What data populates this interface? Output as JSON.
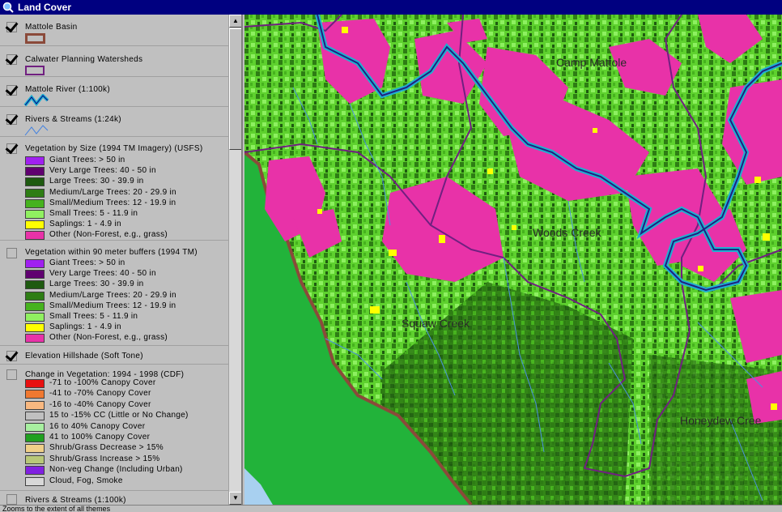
{
  "window": {
    "title": "Land Cover"
  },
  "legend": {
    "themes": [
      {
        "name": "Mattole Basin",
        "checked": true
      },
      {
        "name": "Calwater Planning Watersheds",
        "checked": true
      },
      {
        "name": "Mattole River (1:100k)",
        "checked": true
      },
      {
        "name": "Rivers & Streams (1:24k)",
        "checked": true
      },
      {
        "name": "Vegetation by Size (1994 TM Imagery) (USFS)",
        "checked": true,
        "classes": [
          {
            "label": "Giant Trees: > 50 in",
            "color": "#a020f0"
          },
          {
            "label": "Very Large Trees: 40 - 50 in",
            "color": "#600070"
          },
          {
            "label": "Large Trees: 30 - 39.9 in",
            "color": "#1e5a10"
          },
          {
            "label": "Medium/Large Trees: 20 - 29.9 in",
            "color": "#2e7d14"
          },
          {
            "label": "Small/Medium Trees: 12 - 19.9 in",
            "color": "#46b21e"
          },
          {
            "label": "Small Trees: 5 - 11.9 in",
            "color": "#90f060"
          },
          {
            "label": "Saplings: 1 - 4.9 in",
            "color": "#ffff00"
          },
          {
            "label": "Other (Non-Forest, e.g., grass)",
            "color": "#e832a8"
          }
        ]
      },
      {
        "name": "Vegetation within 90 meter buffers (1994 TM)",
        "checked": false,
        "classes": [
          {
            "label": "Giant Trees: > 50 in",
            "color": "#a020f0"
          },
          {
            "label": "Very Large Trees: 40 - 50 in",
            "color": "#600070"
          },
          {
            "label": "Large Trees: 30 - 39.9 in",
            "color": "#1e5a10"
          },
          {
            "label": "Medium/Large Trees: 20 - 29.9 in",
            "color": "#2e7d14"
          },
          {
            "label": "Small/Medium Trees: 12 - 19.9 in",
            "color": "#46b21e"
          },
          {
            "label": "Small Trees: 5 - 11.9 in",
            "color": "#90f060"
          },
          {
            "label": "Saplings: 1 - 4.9 in",
            "color": "#ffff00"
          },
          {
            "label": "Other (Non-Forest, e.g., grass)",
            "color": "#e832a8"
          }
        ]
      },
      {
        "name": "Elevation Hillshade (Soft Tone)",
        "checked": true
      },
      {
        "name": "Change in Vegetation: 1994 - 1998 (CDF)",
        "checked": false,
        "classes": [
          {
            "label": "-71 to -100% Canopy Cover",
            "color": "#e81010"
          },
          {
            "label": "-41 to -70% Canopy Cover",
            "color": "#f07830"
          },
          {
            "label": "-16 to -40% Canopy Cover",
            "color": "#f8b880"
          },
          {
            "label": "15 to -15% CC (Little or No Change)",
            "color": "#c0c0c0"
          },
          {
            "label": "16 to 40% Canopy Cover",
            "color": "#a8f0a0"
          },
          {
            "label": "41 to 100% Canopy Cover",
            "color": "#20a020"
          },
          {
            "label": "Shrub/Grass Decrease > 15%",
            "color": "#f0d088"
          },
          {
            "label": "Shrub/Grass Increase > 15%",
            "color": "#b8c878"
          },
          {
            "label": "Non-veg Change (Including Urban)",
            "color": "#8020e0"
          },
          {
            "label": "Cloud, Fog, Smoke",
            "color": "#d8d8d8"
          }
        ]
      },
      {
        "name": "Rivers & Streams (1:100k)",
        "checked": false
      }
    ]
  },
  "map": {
    "labels": [
      "Camp Mattole",
      "Woods Creek",
      "Squaw Creek",
      "Honeydew Cree"
    ]
  },
  "status": {
    "text": "Zooms to the extent of all themes"
  },
  "icons": {
    "app": "globe-search-icon",
    "scroll_up": "arrow-up-icon",
    "scroll_down": "arrow-down-icon"
  }
}
